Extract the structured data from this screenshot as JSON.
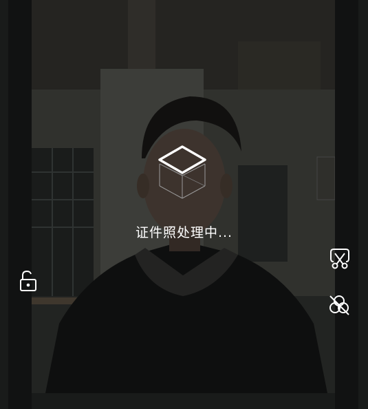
{
  "status": {
    "text": "证件照处理中..."
  },
  "icons": {
    "loader": "cube-icon",
    "lock": "unlock-icon",
    "crop": "crop-icon",
    "blend": "blend-circles-icon"
  },
  "colors": {
    "background": "#1f2120",
    "side_strip": "#151716",
    "text": "#ffffff"
  }
}
